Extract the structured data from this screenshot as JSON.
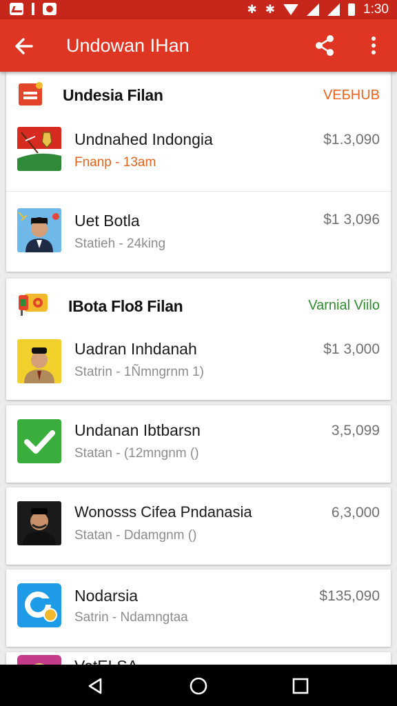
{
  "status_bar": {
    "time": "1:30",
    "left_icons": [
      "gmail-icon",
      "notification-icon",
      "camera-app-icon"
    ],
    "right_icons": [
      "bluetooth-icon",
      "bluetooth-alt-icon",
      "wifi-icon",
      "signal-icon",
      "signal-alt-icon",
      "battery-icon"
    ]
  },
  "app_bar": {
    "title": "Undowan IHan",
    "back_icon": "arrow-left-icon",
    "share_icon": "share-icon",
    "more_icon": "more-vert-icon"
  },
  "colors": {
    "app_bar": "#df3523",
    "status_bar": "#c7261b",
    "accent_orange": "#e8621c",
    "accent_green": "#2e8b2e",
    "background": "#ececec"
  },
  "sections": [
    {
      "title": "Undesia Filan",
      "tag": "VEБHUB",
      "tag_color": "#e8621c",
      "icon": "calendar-icon",
      "items": [
        {
          "title": "Undnahed Indongia",
          "subtitle": "Fnanp - 13am",
          "price": "$1.3,090",
          "thumb": "flag-thumbnail-icon"
        },
        {
          "title": "Uet Botla",
          "subtitle": "Statieh - 24king",
          "price": "$1 3,096",
          "thumb": "portrait-thumbnail-icon"
        }
      ]
    },
    {
      "title": "IBota Flo8 Filan",
      "tag": "Varnial Viilo",
      "tag_color": "#2e8b2e",
      "icon": "ticket-icon",
      "items": [
        {
          "title": "Uadran Inhdanah",
          "subtitle": "Statrin - 1Ñmngrnm 1)",
          "price": "$1 3,000",
          "thumb": "portrait-yellow-thumbnail-icon"
        }
      ]
    }
  ],
  "standalone_items": [
    {
      "title": "Undanan Ibtbarsn",
      "subtitle": "Statan - (12mngnm ()",
      "price": "3,5,099",
      "thumb": "checkmark-icon"
    },
    {
      "title": "Wonosss Cifea Pndanasia",
      "subtitle": "Statan - Ddamgnm ()",
      "price": "6,3,000",
      "thumb": "portrait-dark-thumbnail-icon"
    },
    {
      "title": "Nodarsia",
      "subtitle": "Satrin - Ndamngtaa",
      "price": "$135,090",
      "thumb": "app-logo-icon"
    },
    {
      "title": "VetELSA",
      "subtitle": "",
      "price": "",
      "thumb": "app-thumbnail-icon"
    }
  ],
  "nav_bar": {
    "back_icon": "nav-back-icon",
    "home_icon": "nav-home-icon",
    "recents_icon": "nav-recents-icon"
  }
}
